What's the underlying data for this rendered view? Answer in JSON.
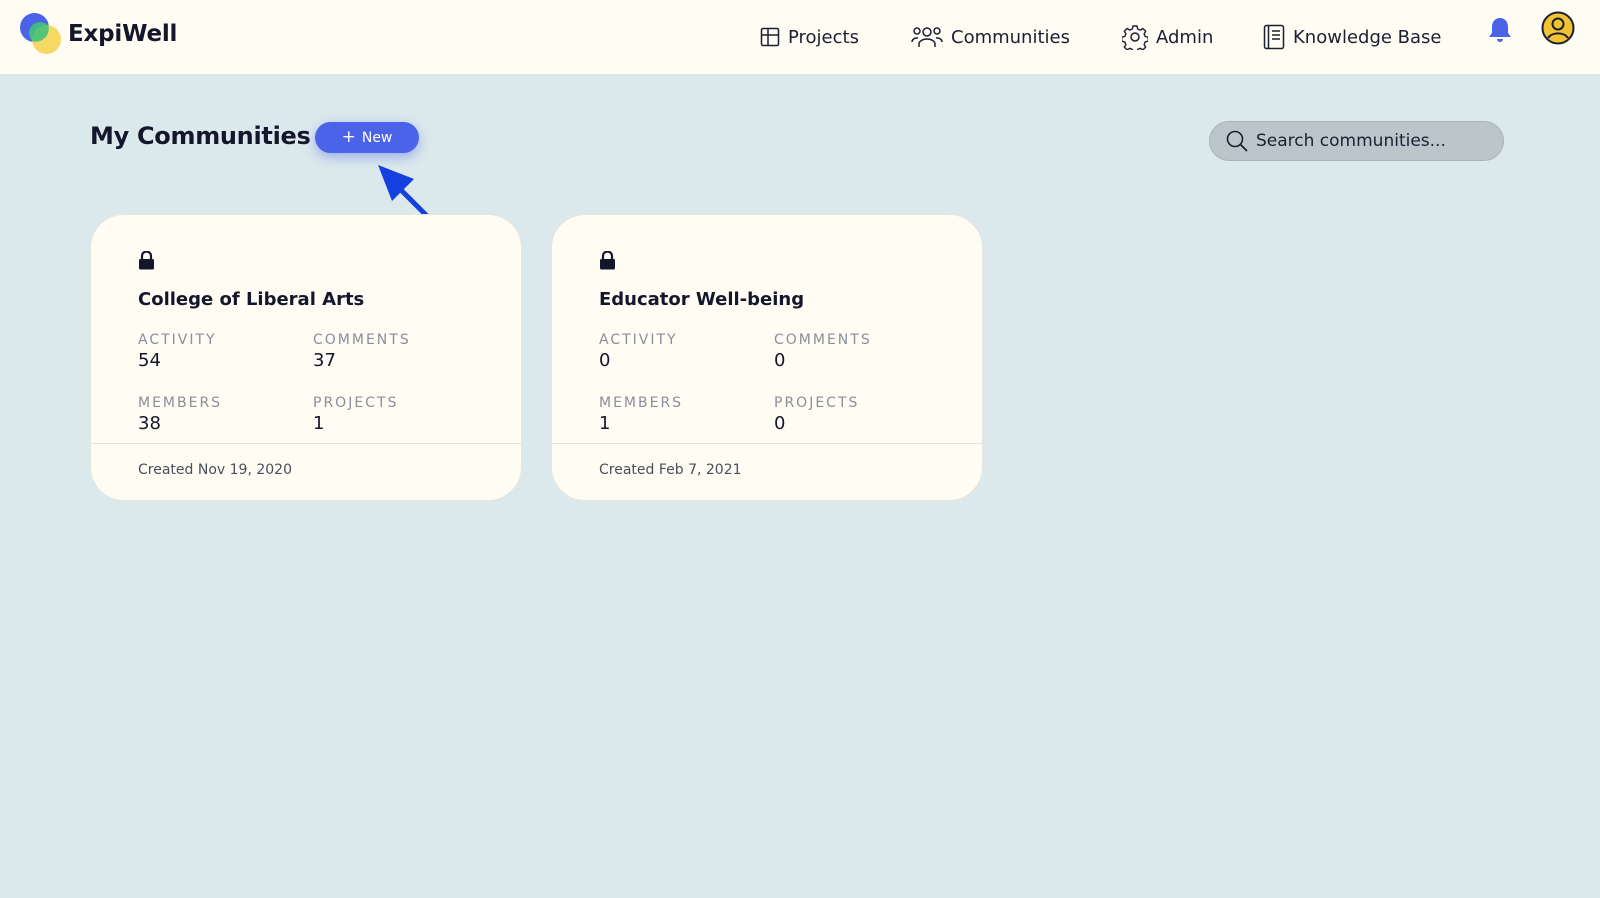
{
  "app": {
    "name": "ExpiWell"
  },
  "nav": {
    "projects": "Projects",
    "communities": "Communities",
    "admin": "Admin",
    "knowledge_base": "Knowledge Base"
  },
  "page": {
    "title": "My Communities",
    "new_button": "New",
    "search_placeholder": "Search communities..."
  },
  "communities": [
    {
      "name": "College of Liberal Arts",
      "private": true,
      "stats": {
        "activity_label": "ACTIVITY",
        "activity": "54",
        "comments_label": "COMMENTS",
        "comments": "37",
        "members_label": "MEMBERS",
        "members": "38",
        "projects_label": "PROJECTS",
        "projects": "1"
      },
      "created": "Created Nov 19, 2020"
    },
    {
      "name": "Educator Well-being",
      "private": true,
      "stats": {
        "activity_label": "ACTIVITY",
        "activity": "0",
        "comments_label": "COMMENTS",
        "comments": "0",
        "members_label": "MEMBERS",
        "members": "1",
        "projects_label": "PROJECTS",
        "projects": "0"
      },
      "created": "Created Feb 7, 2021"
    }
  ],
  "colors": {
    "accent": "#4a63e8",
    "background": "#dce9ec",
    "header": "#fffcf3",
    "bell": "#4a63e8",
    "avatar": "#f2c230",
    "annotation_arrow": "#1440e0"
  },
  "icons": {
    "projects": "grid-icon",
    "communities": "people-icon",
    "admin": "gear-icon",
    "knowledge_base": "book-icon",
    "notifications": "bell-icon",
    "profile": "user-avatar-icon",
    "search": "search-icon",
    "private": "lock-icon"
  }
}
